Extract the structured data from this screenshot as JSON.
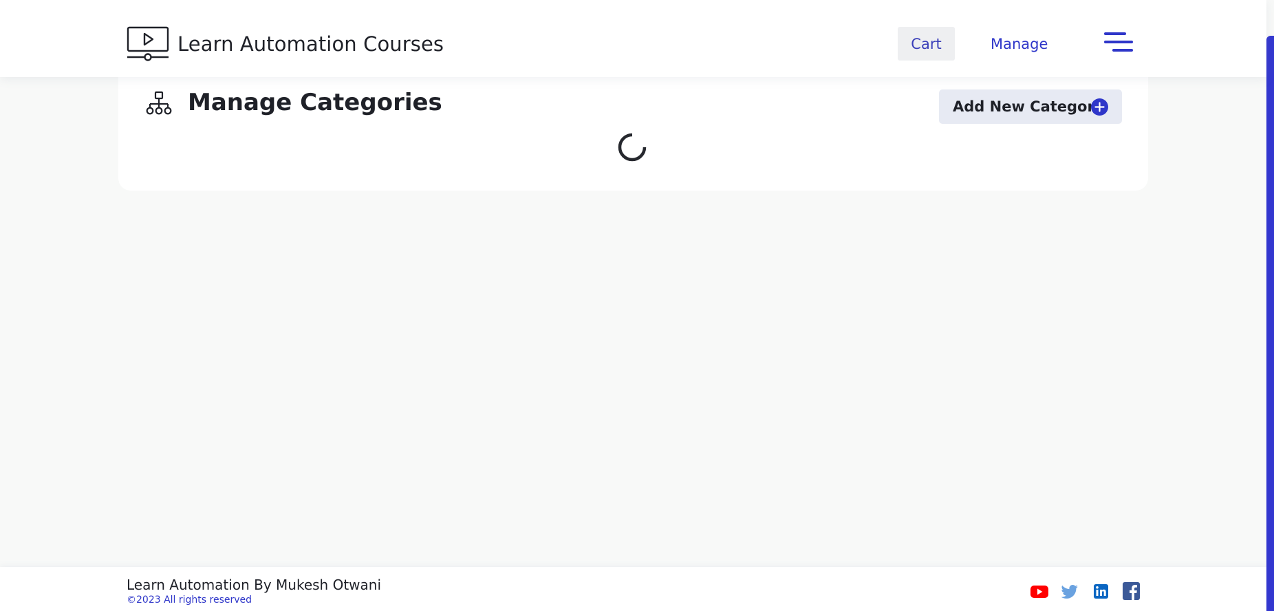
{
  "header": {
    "brand_title": "Learn Automation Courses",
    "brand_icon": "video-monitor-icon",
    "nav": {
      "cart_label": "Cart",
      "manage_label": "Manage",
      "menu_icon": "hamburger-menu-icon"
    }
  },
  "main": {
    "section_icon": "hierarchy-icon",
    "section_title": "Manage Categories",
    "add_button_label": "Add New Category",
    "add_button_icon": "plus-circle-icon",
    "loading_indicator": "loading-spinner"
  },
  "footer": {
    "title": "Learn Automation By Mukesh Otwani",
    "copyright": "©2023 All rights reserved",
    "social": [
      {
        "name": "youtube-icon",
        "color": "#ff0000"
      },
      {
        "name": "twitter-icon",
        "color": "#6aa2e0"
      },
      {
        "name": "linkedin-icon",
        "color": "#0a66c2"
      },
      {
        "name": "facebook-icon",
        "color": "#3b5998"
      }
    ]
  },
  "colors": {
    "accent": "#2e36c9",
    "text": "#1f2128",
    "page_bg": "#f8f9f8",
    "button_bg": "#e7eaf3",
    "scrollbar_thumb": "#3337cf"
  }
}
